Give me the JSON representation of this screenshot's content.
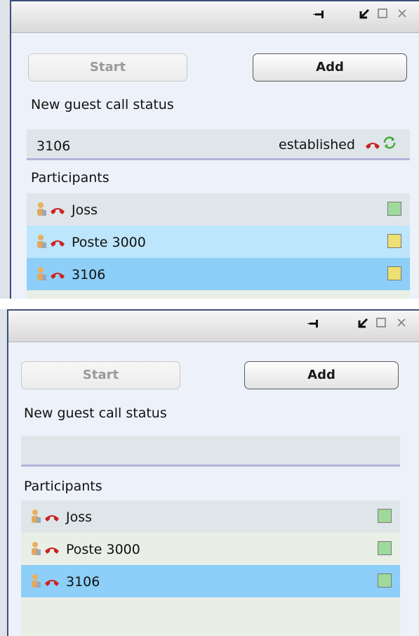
{
  "colors": {
    "row_default": "#dfe6ea",
    "row_alt": "#e9efe7",
    "row_selected": "#8dcff8",
    "row_highlight": "#bde5fb",
    "status_green": "#9fd99c",
    "status_yellow": "#eddf72",
    "hangup_red": "#cc2222"
  },
  "panels": [
    {
      "titlebar": {
        "icons": [
          "pin-icon",
          "restore-icon",
          "maximize-icon",
          "close-icon"
        ]
      },
      "start_label": "Start",
      "add_label": "Add",
      "call_status_label": "New guest call status",
      "call": {
        "number": "3106",
        "status": "established"
      },
      "participants_label": "Participants",
      "participants": [
        {
          "name": "Joss",
          "status": "green"
        },
        {
          "name": "Poste 3000",
          "status": "yellow"
        },
        {
          "name": "3106",
          "status": "yellow"
        }
      ]
    },
    {
      "titlebar": {
        "icons": [
          "pin-icon",
          "restore-icon",
          "maximize-icon",
          "close-icon"
        ]
      },
      "start_label": "Start",
      "add_label": "Add",
      "call_status_label": "New guest call status",
      "call": {
        "number": "",
        "status": ""
      },
      "participants_label": "Participants",
      "participants": [
        {
          "name": "Joss",
          "status": "green"
        },
        {
          "name": "Poste 3000",
          "status": "green"
        },
        {
          "name": "3106",
          "status": "green"
        }
      ]
    }
  ]
}
